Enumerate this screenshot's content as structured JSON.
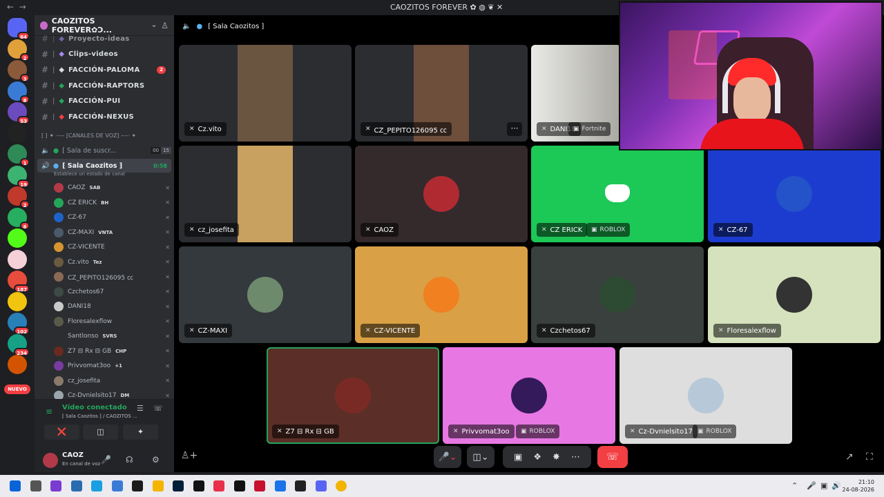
{
  "window": {
    "title": "CAOZITOS FOREVER",
    "title_emoji": "✿ ◍ ❦ ✕"
  },
  "guilds": [
    {
      "name": "discord-home-icon",
      "badge": "64",
      "color": "#5865f2"
    },
    {
      "name": "guild-1",
      "badge": "2",
      "color": "#e0a03a"
    },
    {
      "name": "guild-2",
      "badge": "3",
      "color": "#8a5a3a"
    },
    {
      "name": "guild-3",
      "badge": "8",
      "color": "#3a7bd5"
    },
    {
      "name": "guild-4",
      "badge": "53",
      "color": "#6b4bbd"
    },
    {
      "name": "guild-elite",
      "badge": "",
      "color": "#222"
    },
    {
      "name": "guild-5",
      "badge": "1",
      "color": "#2e8b57"
    },
    {
      "name": "guild-6",
      "badge": "19",
      "color": "#3cb371"
    },
    {
      "name": "guild-7",
      "badge": "2",
      "color": "#c0392b"
    },
    {
      "name": "guild-8",
      "badge": "6",
      "color": "#27ae60"
    },
    {
      "name": "guild-kick",
      "badge": "",
      "color": "#53fc18"
    },
    {
      "name": "guild-9",
      "badge": "",
      "color": "#f5d0d8"
    },
    {
      "name": "guild-10",
      "badge": "187",
      "color": "#e74c3c"
    },
    {
      "name": "guild-11",
      "badge": "",
      "color": "#f1c40f"
    },
    {
      "name": "guild-12",
      "badge": "102",
      "color": "#2980b9"
    },
    {
      "name": "guild-13",
      "badge": "234",
      "color": "#16a085"
    },
    {
      "name": "guild-14",
      "badge": "",
      "color": "#d35400"
    }
  ],
  "nuevo_label": "NUEVO",
  "server": {
    "name": "CAOZITOS FOREVER✿Ↄ...",
    "channels": [
      {
        "name": "Proyecto-ideas",
        "badge": ""
      },
      {
        "name": "Clips-videos",
        "badge": ""
      },
      {
        "name": "FACCIÓN-PALOMA",
        "badge": "2"
      },
      {
        "name": "FACCIÓN-RAPTORS",
        "badge": ""
      },
      {
        "name": "FACCIÓN-PUI",
        "badge": ""
      },
      {
        "name": "FACCIÓN-NEXUS",
        "badge": ""
      }
    ],
    "category": "⁅ ⁆ ✦ ·‒‒ ⁅CANALES DE VOZ⁆ ‒‒· ✦",
    "voice_channels": [
      {
        "name": "⁅ Sala de suscr...",
        "count_a": "00",
        "count_b": "15"
      },
      {
        "name": "⁅ Sala Caozitos ⁆",
        "timer": "0:58"
      }
    ],
    "status_hint": "Establece un estado de canal",
    "members": [
      {
        "name": "CAOZ",
        "tag": "SAB",
        "color": "#b23a48"
      },
      {
        "name": "CZ ERICK",
        "tag": "BH",
        "color": "#23a55a"
      },
      {
        "name": "CZ-67",
        "tag": "",
        "color": "#1e63c9"
      },
      {
        "name": "CZ-MAXI",
        "tag": "VNTA",
        "color": "#4a5a6a"
      },
      {
        "name": "CZ-VICENTE",
        "tag": "",
        "color": "#d6952f"
      },
      {
        "name": "Cz.vito",
        "tag": "Tez",
        "color": "#6a5a40"
      },
      {
        "name": "CZ_PEPITO126095 ㏄",
        "tag": "",
        "color": "#8a6a55"
      },
      {
        "name": "Czchetos67",
        "tag": "",
        "color": "#3d4a45"
      },
      {
        "name": "DANI18",
        "tag": "",
        "color": "#c9c9c9"
      },
      {
        "name": "Floresalexflow",
        "tag": "",
        "color": "#5a5a4a"
      },
      {
        "name": "Santlonso",
        "tag": "SVRS",
        "color": "#2b2d31"
      },
      {
        "name": "Z7 ⊟ Rx ⊟ GB",
        "tag": "CHP",
        "color": "#6a2a20"
      },
      {
        "name": "Privvomat3oo",
        "tag": "+1",
        "color": "#7a3aa0"
      },
      {
        "name": "cz_josefita",
        "tag": "",
        "color": "#8a7a6a"
      },
      {
        "name": "Cz-Dvnielsito17",
        "tag": "DM",
        "color": "#9aa5ad"
      }
    ]
  },
  "connection": {
    "title": "Vídeo conectado",
    "subtitle": "⁅ Sala Caozitos ⁆ / CAOZITOS ..."
  },
  "user": {
    "name": "CAOZ",
    "status": "En canal de voz"
  },
  "main": {
    "channel_title": "⁅ Sala Caozitos ⁆"
  },
  "tiles": [
    {
      "name": "Cz.vito",
      "bg": "#2b2d31",
      "game": ""
    },
    {
      "name": "CZ_PEPITO126095 ㏄",
      "bg": "#2b2d31",
      "game": ""
    },
    {
      "name": "DANI18",
      "bg": "#c8c8c6",
      "game": "Fortnite"
    },
    {
      "name": "cz_josefita",
      "bg": "#2b2d31",
      "game": ""
    },
    {
      "name": "CAOZ",
      "bg": "#342a2c",
      "game": ""
    },
    {
      "name": "CZ ERICK",
      "bg": "#1cc856",
      "game": "ROBLOX"
    },
    {
      "name": "CZ-67",
      "bg": "#1c3ccf",
      "game": ""
    },
    {
      "name": "CZ-MAXI",
      "bg": "#33393d",
      "game": ""
    },
    {
      "name": "CZ-VICENTE",
      "bg": "#d9a045",
      "game": ""
    },
    {
      "name": "Czchetos67",
      "bg": "#3a403d",
      "game": ""
    },
    {
      "name": "Floresalexflow",
      "bg": "#d5e2bd",
      "game": ""
    },
    {
      "name": "Z7 ⊟ Rx ⊟ GB",
      "bg": "#5b2f27",
      "game": ""
    },
    {
      "name": "Privvomat3oo",
      "bg": "#e777e3",
      "game": "ROBLOX"
    },
    {
      "name": "Cz-Dvnielsito17",
      "bg": "#dedede",
      "game": "ROBLOX"
    }
  ],
  "colors": {
    "accent_green": "#23a55a",
    "danger_red": "#f23f43",
    "blurple": "#5865f2"
  },
  "taskbar": {
    "time": "21:10",
    "date": "24-08-2026"
  }
}
